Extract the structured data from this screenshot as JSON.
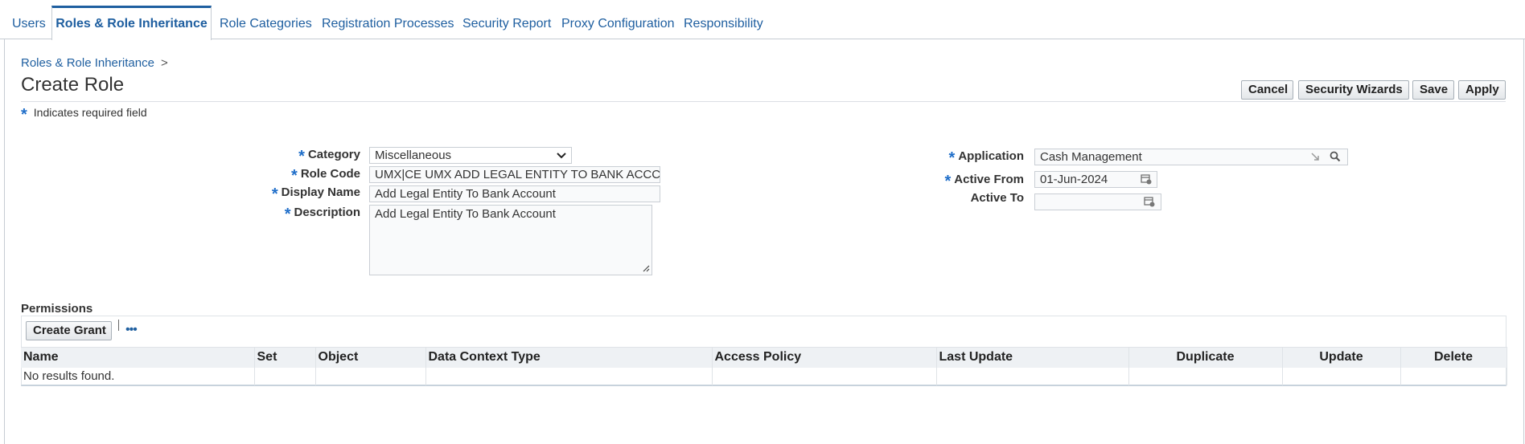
{
  "tabs": [
    {
      "label": "Users"
    },
    {
      "label": "Roles & Role Inheritance"
    },
    {
      "label": "Role Categories"
    },
    {
      "label": "Registration Processes"
    },
    {
      "label": "Security Report"
    },
    {
      "label": "Proxy Configuration"
    },
    {
      "label": "Responsibility"
    }
  ],
  "breadcrumb": {
    "link": "Roles & Role Inheritance",
    "separator": ">"
  },
  "page": {
    "title": "Create Role"
  },
  "buttons": {
    "cancel": "Cancel",
    "security_wizards": "Security Wizards",
    "save": "Save",
    "apply": "Apply"
  },
  "required_note": {
    "star": "*",
    "text": "Indicates required field"
  },
  "form": {
    "category": {
      "label": "Category",
      "value": "Miscellaneous"
    },
    "role_code": {
      "label": "Role Code",
      "value": "UMX|CE UMX ADD LEGAL ENTITY TO BANK ACCC"
    },
    "display_name": {
      "label": "Display Name",
      "value": "Add Legal Entity To Bank Account"
    },
    "description": {
      "label": "Description",
      "value": "Add Legal Entity To Bank Account"
    },
    "application": {
      "label": "Application",
      "value": "Cash Management"
    },
    "active_from": {
      "label": "Active From",
      "value": "01-Jun-2024"
    },
    "active_to": {
      "label": "Active To",
      "value": ""
    }
  },
  "permissions": {
    "title": "Permissions",
    "create_grant_label": "Create Grant",
    "more_icon": "•••",
    "columns": [
      "Name",
      "Set",
      "Object",
      "Data Context Type",
      "Access Policy",
      "Last Update",
      "Duplicate",
      "Update",
      "Delete"
    ],
    "empty_text": "No results found."
  },
  "icons": {
    "search": "search-icon",
    "calendar": "calendar-icon",
    "clear": "clear-field-icon",
    "chevron": "chevron-down-icon",
    "resize": "resize-handle-icon"
  },
  "colors": {
    "accent": "#1f5fa0",
    "required_star": "#1f6ec9"
  }
}
